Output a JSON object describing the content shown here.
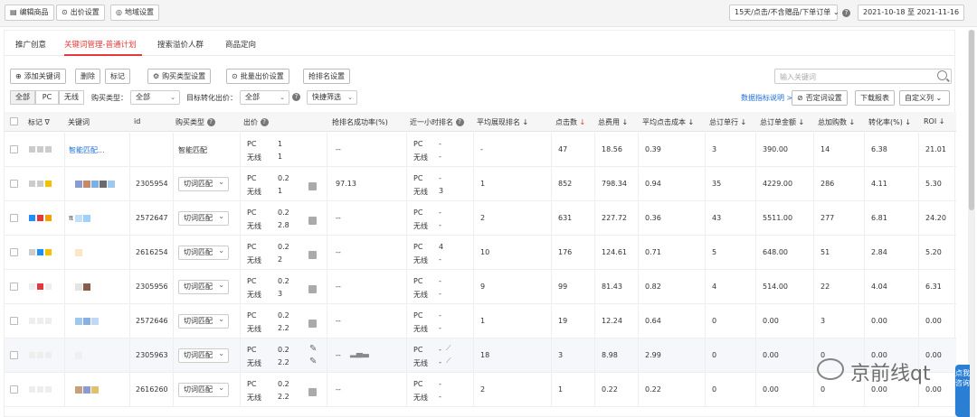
{
  "toolbar": {
    "edit_goods": "编辑商品",
    "bid_settings": "出价设置",
    "region_settings": "地域设置",
    "attribution": "15天/点击/不含赠品/下单订单",
    "date_range": "2021-10-18 至 2021-11-16"
  },
  "tabs": [
    "推广创意",
    "关键词管理-普通计划",
    "搜索溢价人群",
    "商品定向"
  ],
  "actions": {
    "add_keyword": "添加关键词",
    "delete": "删除",
    "mark": "标记",
    "buy_type_settings": "购买类型设置",
    "batch_bid_settings": "批量出价设置",
    "rank_settings": "抢排名设置",
    "search_placeholder": "输入关键词"
  },
  "filters": {
    "seg_all": "全部",
    "seg_pc": "PC",
    "seg_wireless": "无线",
    "buy_type_label": "购买类型：",
    "buy_type_value": "全部",
    "target_bid_label": "目标转化出价：",
    "target_bid_value": "全部",
    "quick_filter": "快捷筛选",
    "metric_help": "数据指标说明 >",
    "neg_keyword_settings": "否定词设置",
    "download_report": "下载报表",
    "custom_columns": "自定义列"
  },
  "columns": [
    "标记",
    "关键词",
    "id",
    "购买类型",
    "出价",
    "抢排名成功率(%)",
    "近一小时排名",
    "平均展现排名",
    "点击数",
    "总费用",
    "平均点击成本",
    "总订单行",
    "总订单金额",
    "总加购数",
    "转化率(%)",
    "ROI"
  ],
  "rows": [
    {
      "keyword": "智能匹配...",
      "id": "",
      "buy": "智能匹配",
      "pc_bid": "1",
      "wl_bid": "1",
      "rank_rate": "--",
      "pc_rank": "-",
      "wl_rank": "-",
      "avg_rank": "-",
      "clicks": "47",
      "cost": "18.56",
      "cpc": "0.39",
      "orders": "3",
      "amount": "390.00",
      "carts": "14",
      "cvr": "6.38",
      "roi": "21.01"
    },
    {
      "keyword": "",
      "id": "2305954",
      "buy": "切词匹配",
      "pc_bid": "0.2",
      "wl_bid": "1",
      "rank_rate": "97.13",
      "pc_rank": "-",
      "wl_rank": "3",
      "avg_rank": "1",
      "clicks": "852",
      "cost": "798.34",
      "cpc": "0.94",
      "orders": "35",
      "amount": "4229.00",
      "carts": "286",
      "cvr": "4.11",
      "roi": "5.30"
    },
    {
      "keyword": "π",
      "id": "2572647",
      "buy": "切词匹配",
      "pc_bid": "0.2",
      "wl_bid": "2.8",
      "rank_rate": "--",
      "pc_rank": "-",
      "wl_rank": "-",
      "avg_rank": "2",
      "clicks": "631",
      "cost": "227.72",
      "cpc": "0.36",
      "orders": "43",
      "amount": "5511.00",
      "carts": "277",
      "cvr": "6.81",
      "roi": "24.20"
    },
    {
      "keyword": "",
      "id": "2616254",
      "buy": "切词匹配",
      "pc_bid": "0.2",
      "wl_bid": "2",
      "rank_rate": "--",
      "pc_rank": "4",
      "wl_rank": "-",
      "avg_rank": "10",
      "clicks": "176",
      "cost": "124.61",
      "cpc": "0.71",
      "orders": "5",
      "amount": "648.00",
      "carts": "51",
      "cvr": "2.84",
      "roi": "5.20"
    },
    {
      "keyword": "",
      "id": "2305956",
      "buy": "切词匹配",
      "pc_bid": "0.2",
      "wl_bid": "3",
      "rank_rate": "--",
      "pc_rank": "-",
      "wl_rank": "-",
      "avg_rank": "9",
      "clicks": "99",
      "cost": "81.43",
      "cpc": "0.82",
      "orders": "4",
      "amount": "514.00",
      "carts": "22",
      "cvr": "4.04",
      "roi": "6.31"
    },
    {
      "keyword": "",
      "id": "2572646",
      "buy": "切词匹配",
      "pc_bid": "0.2",
      "wl_bid": "2.2",
      "rank_rate": "--",
      "pc_rank": "-",
      "wl_rank": "-",
      "avg_rank": "1",
      "clicks": "19",
      "cost": "12.24",
      "cpc": "0.64",
      "orders": "0",
      "amount": "0.00",
      "carts": "3",
      "cvr": "0.00",
      "roi": "0.00"
    },
    {
      "keyword": "",
      "id": "2305963",
      "buy": "切词匹配",
      "pc_bid": "0.2",
      "wl_bid": "2.2",
      "rank_rate": "--",
      "pc_rank": "-",
      "wl_rank": "-",
      "avg_rank": "18",
      "clicks": "3",
      "cost": "8.98",
      "cpc": "2.99",
      "orders": "0",
      "amount": "0.00",
      "carts": "0",
      "cvr": "0.00",
      "roi": "0.00"
    },
    {
      "keyword": "",
      "id": "2616260",
      "buy": "切词匹配",
      "pc_bid": "0.2",
      "wl_bid": "2.2",
      "rank_rate": "--",
      "pc_rank": "-",
      "wl_rank": "-",
      "avg_rank": "2",
      "clicks": "1",
      "cost": "0.22",
      "cpc": "0.22",
      "orders": "0",
      "amount": "0.00",
      "carts": "0",
      "cvr": "0.00",
      "roi": "0.00"
    }
  ],
  "labels": {
    "pc": "PC",
    "wireless": "无线"
  },
  "watermark": "京前线qt",
  "float_button": "点我咨询",
  "colors": {
    "accent": "#e4393c",
    "link": "#1e6fd9"
  }
}
